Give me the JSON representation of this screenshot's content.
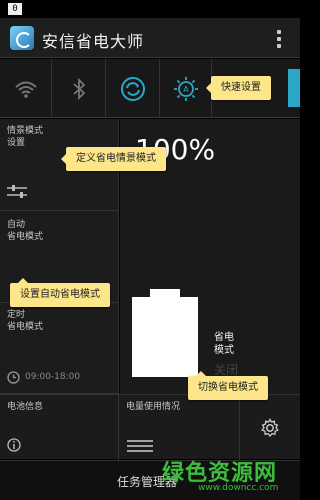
{
  "status_bar": {
    "badge": "0"
  },
  "header": {
    "title": "安信省电大师"
  },
  "quick_bar": {
    "icons": [
      "wifi-icon",
      "bluetooth-icon",
      "sync-icon",
      "brightness-icon",
      "data-icon"
    ],
    "active_color": "#2aa7c9"
  },
  "left_panel": {
    "scene_mode_line1": "情景模式",
    "scene_mode_line2": "设置",
    "auto_line1": "自动",
    "auto_line2": "省电模式",
    "timer_line1": "定时",
    "timer_line2": "省电模式",
    "timer_range": "09:00-18:00"
  },
  "main_panel": {
    "battery_percent": "100%",
    "mode_line1": "省电",
    "mode_line2": "模式",
    "mode_state": "关闭"
  },
  "bottom_row": {
    "battery_info": "电池信息",
    "power_usage": "电量使用情况"
  },
  "taskbar": {
    "label": "任务管理器"
  },
  "tooltips": {
    "quick_settings": "快速设置",
    "define_scene": "定义省电情景模式",
    "auto_mode": "设置自动省电模式",
    "switch_mode": "切换省电模式"
  },
  "watermark": {
    "brand": "绿色资源网",
    "url": "www.downcc.com"
  }
}
